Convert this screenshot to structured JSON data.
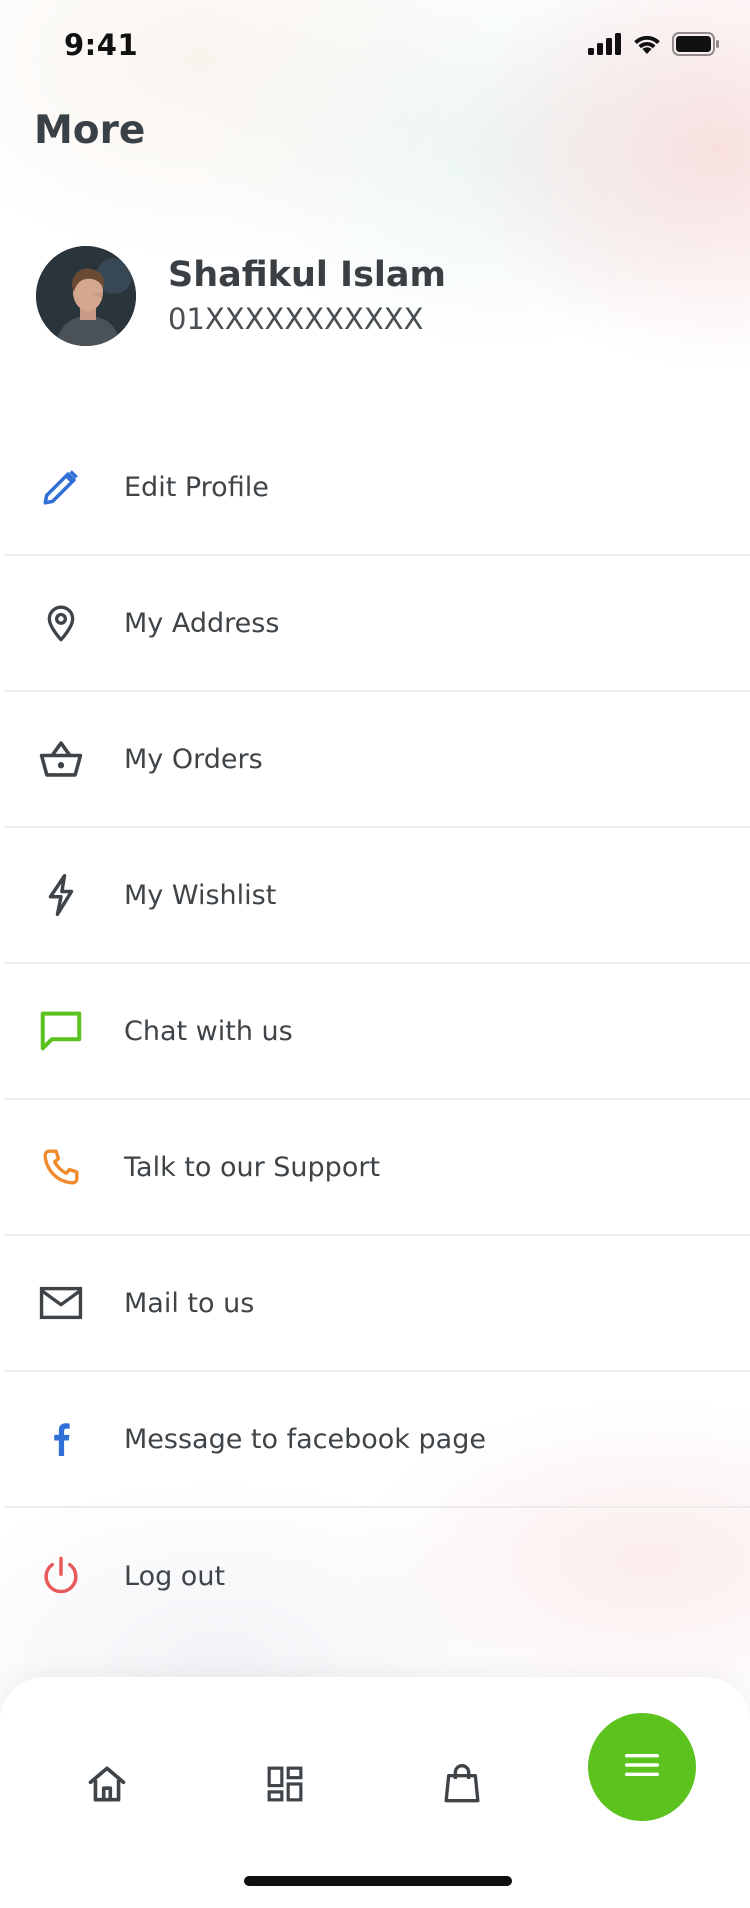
{
  "status_bar": {
    "time": "9:41"
  },
  "page": {
    "title": "More"
  },
  "profile": {
    "name": "Shafikul Islam",
    "phone": "01XXXXXXXXXXX"
  },
  "menu": [
    {
      "label": "Edit Profile",
      "icon": "pencil-icon",
      "color": "#2f6fd6"
    },
    {
      "label": "My Address",
      "icon": "location-pin-icon",
      "color": "#3f4448"
    },
    {
      "label": "My Orders",
      "icon": "basket-icon",
      "color": "#3f4448"
    },
    {
      "label": "My Wishlist",
      "icon": "lightning-icon",
      "color": "#3f4448"
    },
    {
      "label": "Chat with us",
      "icon": "chat-bubble-icon",
      "color": "#5cc21d"
    },
    {
      "label": "Talk to our Support",
      "icon": "phone-icon",
      "color": "#f08a2c"
    },
    {
      "label": "Mail to us",
      "icon": "mail-icon",
      "color": "#3f4448"
    },
    {
      "label": "Message to facebook page",
      "icon": "facebook-icon",
      "color": "#2f6fd6"
    },
    {
      "label": "Log out",
      "icon": "power-icon",
      "color": "#e85a5a"
    }
  ],
  "bottom_nav": {
    "items": [
      "home-icon",
      "categories-icon",
      "shopping-bag-icon",
      "menu-icon"
    ],
    "active_color": "#5cc21d"
  }
}
